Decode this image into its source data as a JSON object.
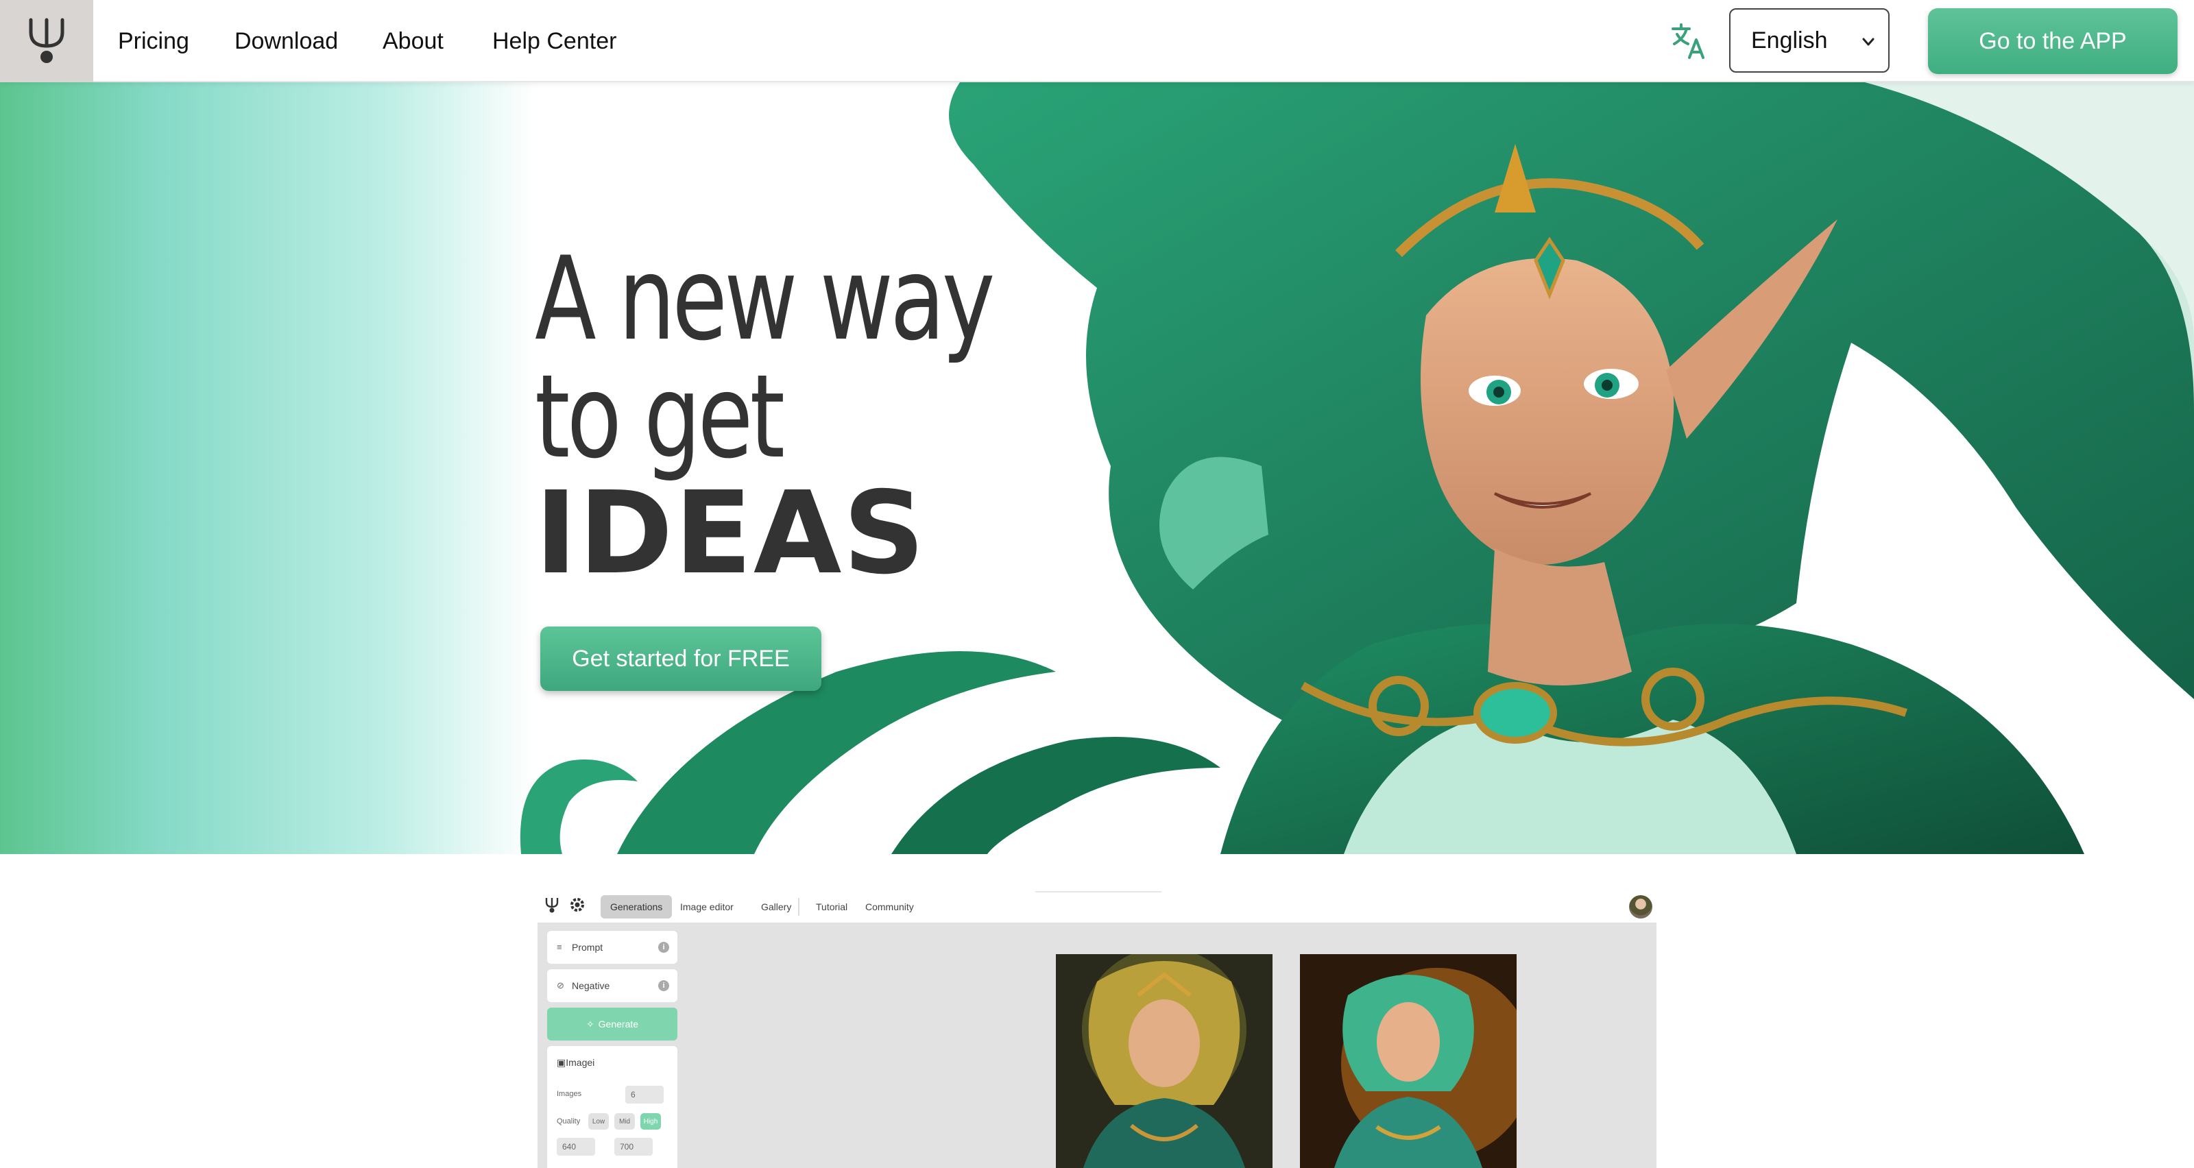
{
  "nav": {
    "links": [
      {
        "label": "Pricing"
      },
      {
        "label": "Download"
      },
      {
        "label": "About"
      },
      {
        "label": "Help Center"
      }
    ],
    "language": "English",
    "app_button": "Go to the APP"
  },
  "hero": {
    "headline": {
      "line1": "A new way",
      "line2": "to get",
      "line3": "IDEAS"
    },
    "cta": "Get started for FREE"
  },
  "preview": {
    "tabs": [
      {
        "label": "Generations",
        "active": true
      },
      {
        "label": "Image editor"
      },
      {
        "label": "Gallery"
      },
      {
        "label": "Tutorial"
      },
      {
        "label": "Community"
      }
    ],
    "sidebar": {
      "prompt": "Prompt",
      "negative": "Negative",
      "generate": "Generate",
      "image": "Image",
      "images_label": "Images",
      "images_value": "6",
      "quality_label": "Quality",
      "quality_options": [
        "Low",
        "Mid",
        "High"
      ],
      "quality_selected": "High",
      "width_value": "640",
      "height_value": "700"
    }
  },
  "colors": {
    "accent": "#4fb98b",
    "hero_gradient_start": "#5cc58f",
    "hero_gradient_end": "#bdeee5",
    "headline": "#333333",
    "hair": "#1f8a63"
  }
}
